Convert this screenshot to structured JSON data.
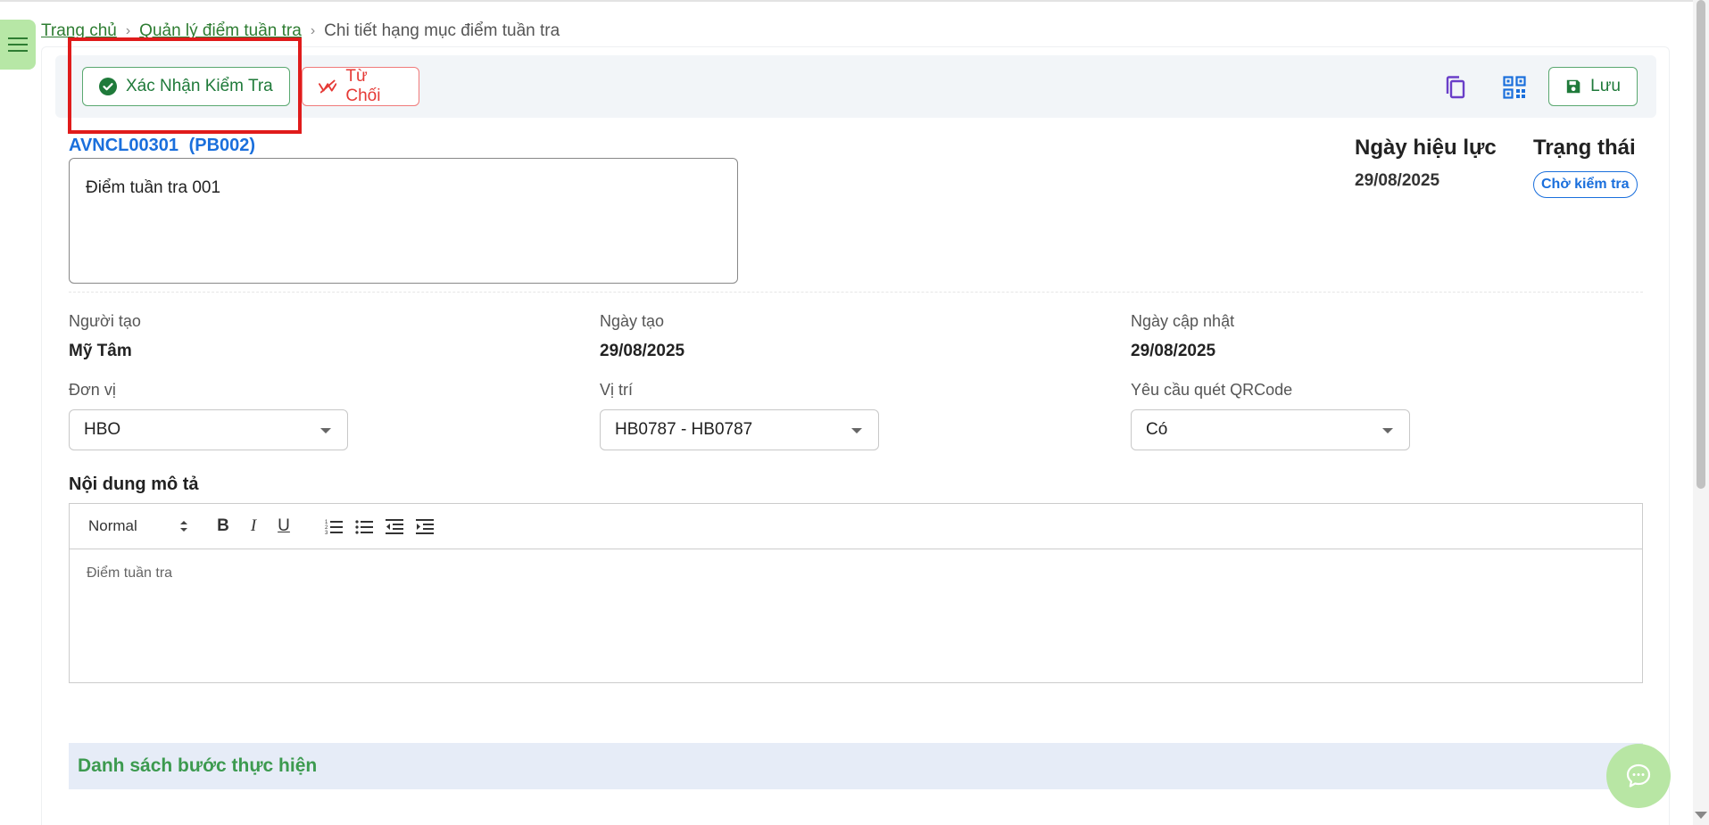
{
  "breadcrumb": {
    "home": "Trang chủ",
    "parent": "Quản lý điểm tuần tra",
    "current": "Chi tiết hạng mục điểm tuần tra"
  },
  "toolbar": {
    "confirm_label": "Xác Nhận Kiểm Tra",
    "reject_label": "Từ Chối",
    "save_label": "Lưu"
  },
  "record": {
    "code": "AVNCL00301",
    "sub_code": "(PB002)",
    "title": "Điểm tuần tra 001",
    "effective_label": "Ngày hiệu lực",
    "effective_date": "29/08/2025",
    "status_label": "Trạng thái",
    "status_value": "Chờ kiểm tra"
  },
  "fields": {
    "creator_label": "Người tạo",
    "creator_value": "Mỹ Tâm",
    "created_label": "Ngày tạo",
    "created_value": "29/08/2025",
    "updated_label": "Ngày cập nhật",
    "updated_value": "29/08/2025",
    "unit_label": "Đơn vị",
    "unit_value": "HBO",
    "location_label": "Vị trí",
    "location_value": "HB0787 - HB0787",
    "qr_label": "Yêu cầu quét QRCode",
    "qr_value": "Có"
  },
  "description": {
    "section_title": "Nội dung mô tả",
    "format_value": "Normal",
    "bold": "B",
    "italic": "I",
    "underline": "U",
    "placeholder": "Điểm tuần tra"
  },
  "steps": {
    "title": "Danh sách bước thực hiện"
  },
  "colors": {
    "accent_green": "#1f7a3a",
    "link_blue": "#1a6fdc",
    "reject_red": "#e53935",
    "highlight_red": "#e01b1b"
  }
}
